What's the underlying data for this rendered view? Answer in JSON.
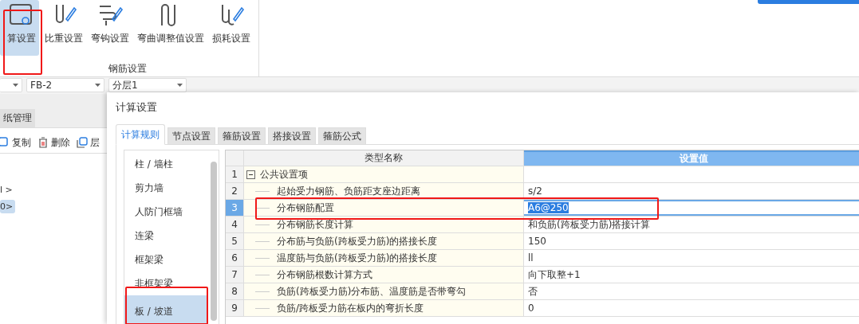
{
  "ribbon": {
    "buttons": [
      {
        "label": "算设置",
        "selected": true
      },
      {
        "label": "比重设置",
        "selected": false
      },
      {
        "label": "弯钩设置",
        "selected": false
      },
      {
        "label": "弯曲调整值设置",
        "selected": false
      },
      {
        "label": "损耗设置",
        "selected": false
      }
    ],
    "group_label": "钢筋设置"
  },
  "selectors": [
    {
      "value": "FB-2"
    },
    {
      "value": "分层1"
    }
  ],
  "background": {
    "tab": "纸管理",
    "actions": [
      "复制",
      "删除",
      "层"
    ],
    "tree_items": [
      {
        "label": "l >",
        "selected": false
      },
      {
        "label": "0>",
        "selected": true
      }
    ]
  },
  "dialog": {
    "title": "计算设置",
    "tabs": [
      {
        "label": "计算规则",
        "selected": true
      },
      {
        "label": "节点设置",
        "selected": false
      },
      {
        "label": "箍筋设置",
        "selected": false
      },
      {
        "label": "搭接设置",
        "selected": false
      },
      {
        "label": "箍筋公式",
        "selected": false
      }
    ],
    "categories": [
      {
        "label": "柱 / 墙柱",
        "selected": false
      },
      {
        "label": "剪力墙",
        "selected": false
      },
      {
        "label": "人防门框墙",
        "selected": false
      },
      {
        "label": "连梁",
        "selected": false
      },
      {
        "label": "框架梁",
        "selected": false
      },
      {
        "label": "非框架梁",
        "selected": false
      },
      {
        "label": "板 / 坡道",
        "selected": true
      }
    ],
    "grid": {
      "columns": [
        "类型名称",
        "设置值"
      ],
      "rows": [
        {
          "number": "1",
          "kind": "group",
          "expanded": true,
          "name": "公共设置项",
          "selected": false
        },
        {
          "number": "2",
          "kind": "item",
          "name": "起始受力钢筋、负筋距支座边距离",
          "value": "s/2",
          "selected": false
        },
        {
          "number": "3",
          "kind": "item",
          "name": "分布钢筋配置",
          "value": "A6@250",
          "selected": true
        },
        {
          "number": "4",
          "kind": "item",
          "name": "分布钢筋长度计算",
          "value": "和负筋(跨板受力筋)搭接计算",
          "selected": false
        },
        {
          "number": "5",
          "kind": "item",
          "name": "分布筋与负筋(跨板受力筋)的搭接长度",
          "value": "150",
          "selected": false
        },
        {
          "number": "6",
          "kind": "item",
          "name": "温度筋与负筋(跨板受力筋)的搭接长度",
          "value": "ll",
          "selected": false
        },
        {
          "number": "7",
          "kind": "item",
          "name": "分布钢筋根数计算方式",
          "value": "向下取整+1",
          "selected": false
        },
        {
          "number": "8",
          "kind": "item",
          "name": "负筋(跨板受力筋)分布筋、温度筋是否带弯勾",
          "value": "否",
          "selected": false
        },
        {
          "number": "9",
          "kind": "item",
          "name": "负筋/跨板受力筋在板内的弯折长度",
          "value": "0",
          "selected": false
        }
      ]
    }
  }
}
